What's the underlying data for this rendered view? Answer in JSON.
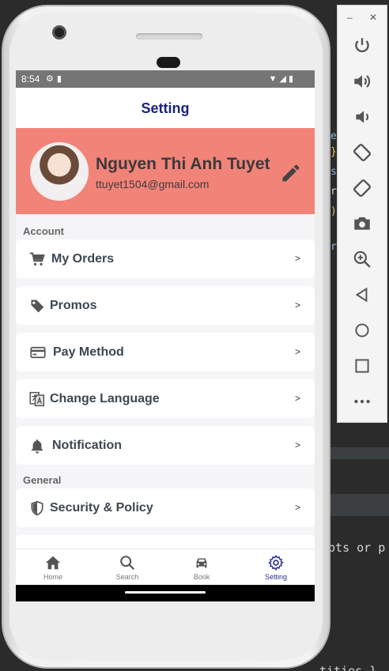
{
  "status": {
    "time": "8:54"
  },
  "header": {
    "title": "Setting"
  },
  "profile": {
    "name": "Nguyen Thi Anh Tuyet",
    "email": "ttuyet1504@gmail.com"
  },
  "sections": {
    "account": "Account",
    "general": "General"
  },
  "menu": [
    {
      "label": "My Orders",
      "icon": "cart-icon",
      "chevron": ">"
    },
    {
      "label": "Promos",
      "icon": "tag-icon",
      "chevron": ">"
    },
    {
      "label": "Pay Method",
      "icon": "credit-card-icon",
      "chevron": ">"
    },
    {
      "label": "Change Language",
      "icon": "translate-icon",
      "chevron": ">"
    },
    {
      "label": "Notification",
      "icon": "bell-icon",
      "chevron": ">"
    },
    {
      "label": "Security & Policy",
      "icon": "shield-icon",
      "chevron": ">"
    }
  ],
  "nav": [
    {
      "label": "Home",
      "icon": "home-icon"
    },
    {
      "label": "Search",
      "icon": "search-icon"
    },
    {
      "label": "Book",
      "icon": "car-icon"
    },
    {
      "label": "Setting",
      "icon": "gear-icon",
      "active": true
    }
  ],
  "emulator": {
    "minimize": "–",
    "close": "✕"
  },
  "ide": {
    "snippet_1": "ipts or p",
    "snippet_2": "tities }"
  },
  "colors": {
    "profile_bg": "#f28379",
    "title": "#1a237e",
    "active_nav": "#2b2f8f"
  }
}
